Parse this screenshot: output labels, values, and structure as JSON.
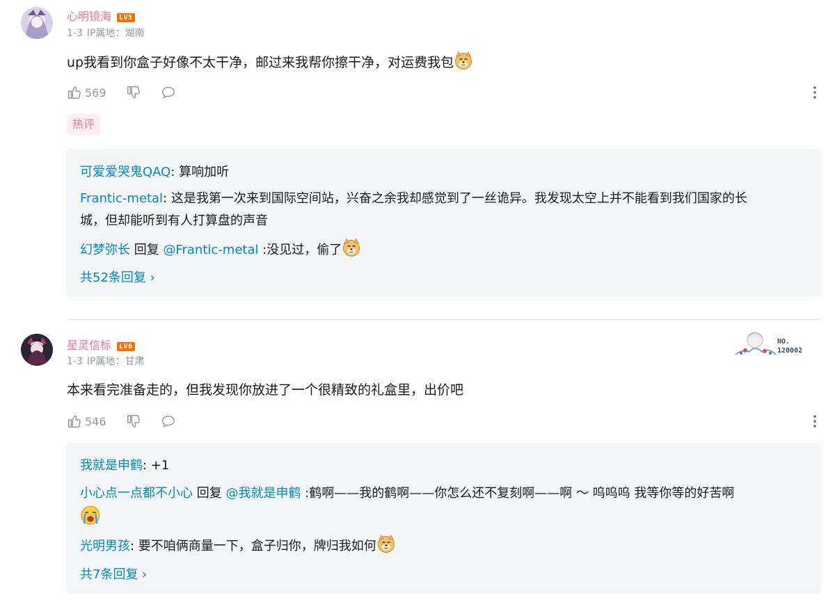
{
  "comments": [
    {
      "username": "心明镜海",
      "level": "LV5",
      "floor": "1-3",
      "ip_label": "IP属地：湖南",
      "text": "up我看到你盒子好像不太干净，邮过来我帮你擦干净，对运费我包",
      "likes": "569",
      "tag": "热评",
      "replies": [
        {
          "user": "可爱爱哭鬼QAQ",
          "sep": ": ",
          "text": "算响加听"
        },
        {
          "user": "Frantic-metal",
          "sep": ": ",
          "text_line1": "这是我第一次来到国际空间站，兴奋之余我却感觉到了一丝诡异。我发现太空上并不能看到我们国家的长",
          "text_line2": "城，但却能听到有人打算盘的声音"
        },
        {
          "user": "幻梦弥长",
          "reply_word": " 回复 ",
          "mention": "@Frantic-metal",
          "text": " :没见过，偷了"
        }
      ],
      "view_more": "共52条回复 ›"
    },
    {
      "username": "星灵信标",
      "level": "LV6",
      "floor": "1-3",
      "ip_label": "IP属地：甘肃",
      "text": "本来看完准备走的，但我发现你放进了一个很精致的礼盒里，出价吧",
      "likes": "546",
      "fan_no_label": "NO.",
      "fan_no_value": "120002",
      "replies": [
        {
          "user": "我就是申鹤",
          "sep": ": ",
          "text": "+1"
        },
        {
          "user": "小心点一点都不小心",
          "reply_word": " 回复 ",
          "mention": "@我就是申鹤",
          "text": " :鹤啊——我的鹤啊——你怎么还不复刻啊——啊 ～  呜呜呜 我等你等的好苦啊"
        },
        {
          "user": "光明男孩",
          "sep": ": ",
          "text": "要不咱俩商量一下，盒子归你，牌归我如何"
        }
      ],
      "view_more": "共7条回复 ›"
    }
  ],
  "icons": {
    "like": "thumbs-up-icon",
    "dislike": "thumbs-down-icon",
    "reply": "chat-bubble-icon",
    "more": "more-vertical-icon",
    "emoji": "doge-emoji-icon",
    "cry": "crying-emoji-icon"
  },
  "colors": {
    "username_pink": "#fb7299",
    "reply_blue": "#008ac5",
    "level_orange": "#ff6c00",
    "reply_bg": "#f4f5f7",
    "meta_gray": "#9499a0"
  }
}
